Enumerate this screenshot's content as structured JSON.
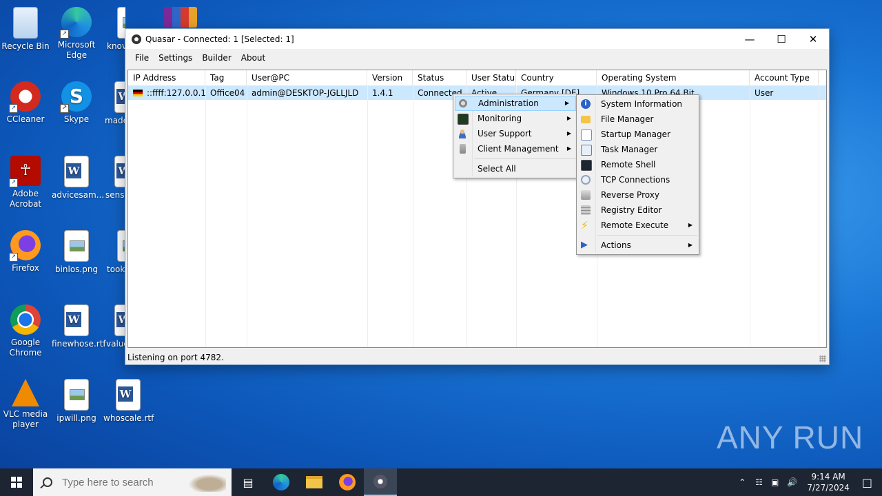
{
  "desktop": {
    "icons": [
      {
        "label": "Recycle Bin"
      },
      {
        "label": "Microsoft Edge"
      },
      {
        "label": "knov"
      },
      {
        "label": "CCleaner"
      },
      {
        "label": "Skype"
      },
      {
        "label": "made"
      },
      {
        "label": "Adobe Acrobat"
      },
      {
        "label": "advicesam..."
      },
      {
        "label": "sense"
      },
      {
        "label": "Firefox"
      },
      {
        "label": "binlos.png"
      },
      {
        "label": "took"
      },
      {
        "label": "Google Chrome"
      },
      {
        "label": "finewhose.rtf"
      },
      {
        "label": "value"
      },
      {
        "label": "VLC media player"
      },
      {
        "label": "ipwill.png"
      },
      {
        "label": "whoscale.rtf"
      }
    ]
  },
  "window": {
    "title": "Quasar - Connected: 1 [Selected: 1]",
    "menu": [
      "File",
      "Settings",
      "Builder",
      "About"
    ],
    "columns": [
      "IP Address",
      "Tag",
      "User@PC",
      "Version",
      "Status",
      "User Status",
      "Country",
      "Operating System",
      "Account Type"
    ],
    "row": {
      "ip": "::ffff:127.0.0.1",
      "tag": "Office04",
      "userpc": "admin@DESKTOP-JGLLJLD",
      "version": "1.4.1",
      "status": "Connected",
      "user_status": "Active",
      "country": "Germany [DE]",
      "os": "Windows 10 Pro 64 Bit",
      "account": "User"
    },
    "status": "Listening on port 4782."
  },
  "context_menu": {
    "items": [
      "Administration",
      "Monitoring",
      "User Support",
      "Client Management"
    ],
    "select_all": "Select All"
  },
  "submenu": {
    "items": [
      "System Information",
      "File Manager",
      "Startup Manager",
      "Task Manager",
      "Remote Shell",
      "TCP Connections",
      "Reverse Proxy",
      "Registry Editor",
      "Remote Execute"
    ],
    "actions": "Actions"
  },
  "taskbar": {
    "search_placeholder": "Type here to search",
    "time": "9:14 AM",
    "date": "7/27/2024"
  },
  "watermark": "ANY RUN"
}
